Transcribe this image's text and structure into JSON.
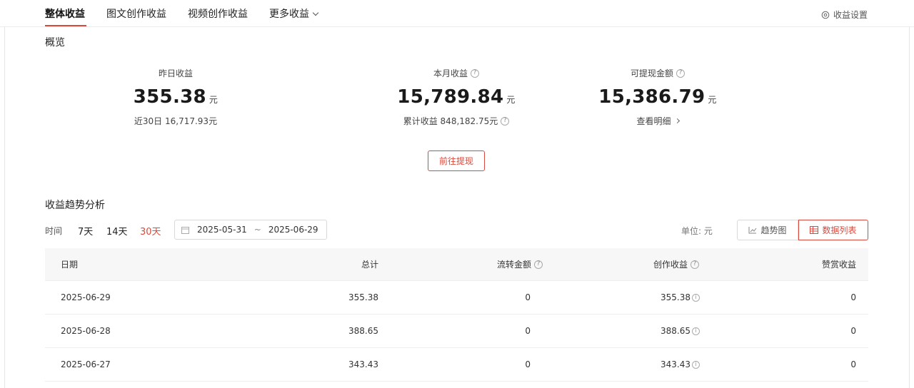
{
  "tabs": [
    {
      "label": "整体收益",
      "active": true
    },
    {
      "label": "图文创作收益",
      "active": false
    },
    {
      "label": "视频创作收益",
      "active": false
    },
    {
      "label": "更多收益",
      "active": false
    }
  ],
  "settings_label": "收益设置",
  "overview": {
    "title": "概览",
    "yesterday": {
      "label": "昨日收益",
      "value": "355.38",
      "unit": "元",
      "sub": "近30日 16,717.93元"
    },
    "month": {
      "label": "本月收益",
      "value": "15,789.84",
      "unit": "元",
      "sub": "累计收益 848,182.75元"
    },
    "withdrawable": {
      "label": "可提现金额",
      "value": "15,386.79",
      "unit": "元",
      "sub": "查看明细"
    },
    "withdraw_button": "前往提现"
  },
  "trend": {
    "title": "收益趋势分析",
    "time_label": "时间",
    "ranges": [
      {
        "label": "7天",
        "active": false
      },
      {
        "label": "14天",
        "active": false
      },
      {
        "label": "30天",
        "active": true
      }
    ],
    "date_start": "2025-05-31",
    "date_sep": "~",
    "date_end": "2025-06-29",
    "unit_label": "单位: 元",
    "view_trend": "趋势图",
    "view_list": "数据列表",
    "accent": "#d84a3d"
  },
  "table": {
    "headers": {
      "date": "日期",
      "total": "总计",
      "flow": "流转金额",
      "create": "创作收益",
      "tip": "赞赏收益"
    },
    "rows": [
      {
        "date": "2025-06-29",
        "total": "355.38",
        "flow": "0",
        "create": "355.38",
        "tip": "0"
      },
      {
        "date": "2025-06-28",
        "total": "388.65",
        "flow": "0",
        "create": "388.65",
        "tip": "0"
      },
      {
        "date": "2025-06-27",
        "total": "343.43",
        "flow": "0",
        "create": "343.43",
        "tip": "0"
      }
    ]
  }
}
